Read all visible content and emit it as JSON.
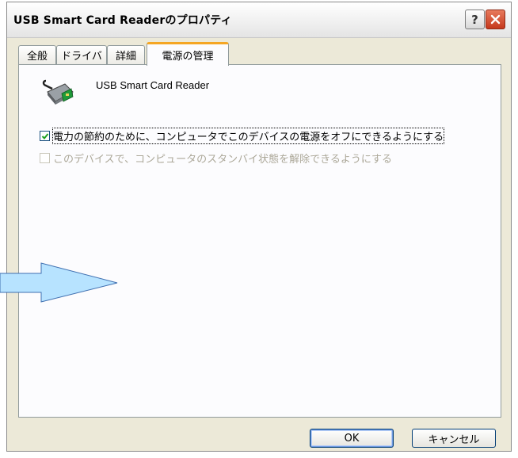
{
  "window": {
    "title": "USB Smart Card Readerのプロパティ",
    "help_label": "?",
    "close_label": "✕"
  },
  "tabs": [
    {
      "label": "全般",
      "active": false
    },
    {
      "label": "ドライバ",
      "active": false
    },
    {
      "label": "詳細",
      "active": false
    },
    {
      "label": "電源の管理",
      "active": true
    }
  ],
  "device": {
    "name": "USB Smart Card Reader",
    "icon": "smart-card-reader-icon"
  },
  "options": [
    {
      "label": "電力の節約のために、コンピュータでこのデバイスの電源をオフにできるようにする",
      "checked": true,
      "enabled": true
    },
    {
      "label": "このデバイスで、コンピュータのスタンバイ状態を解除できるようにする",
      "checked": false,
      "enabled": false
    }
  ],
  "buttons": {
    "ok": "OK",
    "cancel": "キャンセル"
  },
  "annotation": {
    "icon": "right-arrow-icon",
    "color": "#b7e3ff"
  }
}
